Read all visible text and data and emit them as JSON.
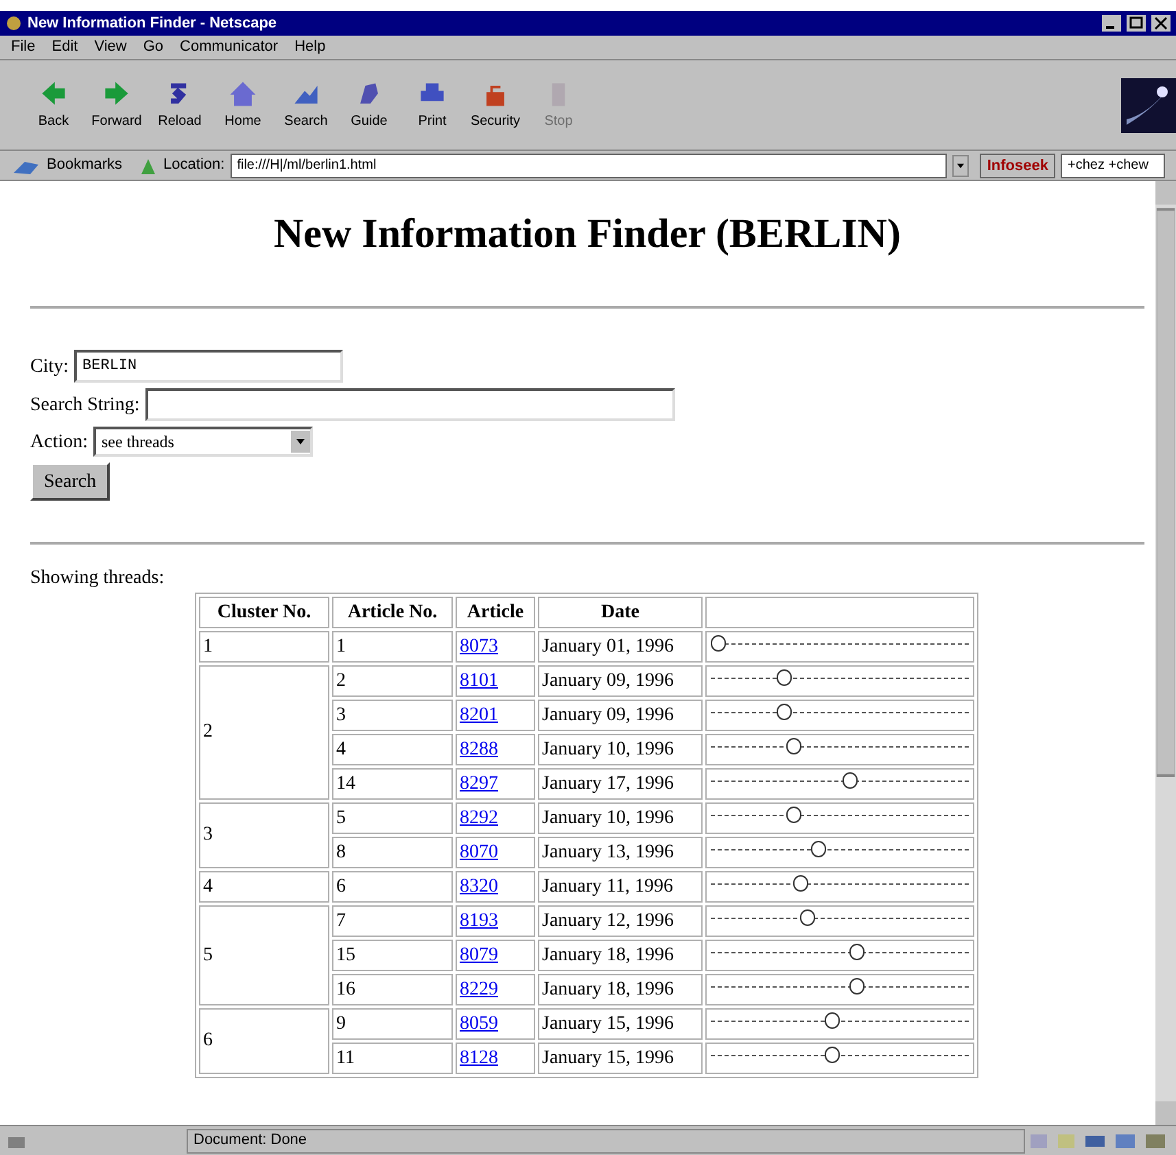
{
  "window": {
    "title": "New Information Finder - Netscape"
  },
  "menu": [
    "File",
    "Edit",
    "View",
    "Go",
    "Communicator",
    "Help"
  ],
  "toolbar": [
    {
      "label": "Back",
      "disabled": false
    },
    {
      "label": "Forward",
      "disabled": false
    },
    {
      "label": "Reload",
      "disabled": false
    },
    {
      "label": "Home",
      "disabled": false
    },
    {
      "label": "Search",
      "disabled": false
    },
    {
      "label": "Guide",
      "disabled": false
    },
    {
      "label": "Print",
      "disabled": false
    },
    {
      "label": "Security",
      "disabled": false
    },
    {
      "label": "Stop",
      "disabled": true
    }
  ],
  "location_bar": {
    "bookmarks": "Bookmarks",
    "location_label": "Location:",
    "url": "file:///H|/ml/berlin1.html",
    "search_button": "Infoseek",
    "search_value": "+chez +chew"
  },
  "page": {
    "heading": "New Information Finder (BERLIN)",
    "form": {
      "city_label": "City:",
      "city_value": "BERLIN",
      "search_label": "Search String:",
      "action_label": "Action:",
      "action_value": "see threads",
      "submit": "Search"
    },
    "result_label": "Showing threads:",
    "table": {
      "columns": [
        "Cluster No.",
        "Article No.",
        "Article",
        "Date"
      ],
      "clusters": [
        {
          "number": "1",
          "articles": [
            {
              "article_no": "1",
              "article": "8073",
              "date": "January 01, 1996",
              "level": 0
            }
          ]
        },
        {
          "number": "2",
          "articles": [
            {
              "article_no": "2",
              "article": "8101",
              "date": "January 09, 1996",
              "level": 0.27
            },
            {
              "article_no": "3",
              "article": "8201",
              "date": "January 09, 1996",
              "level": 0.27
            },
            {
              "article_no": "4",
              "article": "8288",
              "date": "January 10, 1996",
              "level": 0.31
            },
            {
              "article_no": "14",
              "article": "8297",
              "date": "January 17, 1996",
              "level": 0.54
            }
          ]
        },
        {
          "number": "3",
          "articles": [
            {
              "article_no": "5",
              "article": "8292",
              "date": "January 10, 1996",
              "level": 0.31
            },
            {
              "article_no": "8",
              "article": "8070",
              "date": "January 13, 1996",
              "level": 0.41
            }
          ]
        },
        {
          "number": "4",
          "articles": [
            {
              "article_no": "6",
              "article": "8320",
              "date": "January 11, 1996",
              "level": 0.34
            }
          ]
        },
        {
          "number": "5",
          "articles": [
            {
              "article_no": "7",
              "article": "8193",
              "date": "January 12, 1996",
              "level": 0.37
            },
            {
              "article_no": "15",
              "article": "8079",
              "date": "January 18, 1996",
              "level": 0.57
            },
            {
              "article_no": "16",
              "article": "8229",
              "date": "January 18, 1996",
              "level": 0.57
            }
          ]
        },
        {
          "number": "6",
          "articles": [
            {
              "article_no": "9",
              "article": "8059",
              "date": "January 15, 1996",
              "level": 0.47
            },
            {
              "article_no": "11",
              "article": "8128",
              "date": "January 15, 1996",
              "level": 0.47
            }
          ]
        }
      ]
    }
  },
  "status_bar": {
    "text": "Document: Done"
  }
}
